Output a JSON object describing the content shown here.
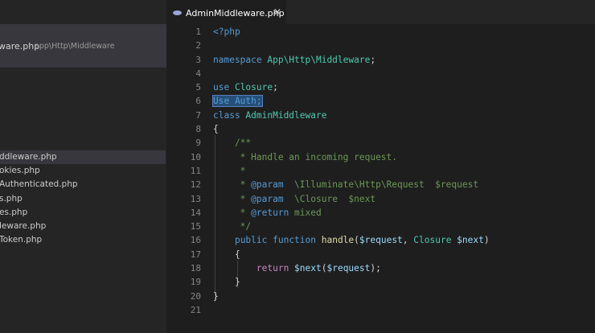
{
  "sidebar": {
    "open_editor": {
      "filename": "ware.php",
      "path": "app\\Http\\Middleware"
    },
    "files": [
      {
        "label": "ddleware.php",
        "active": true
      },
      {
        "label": "okies.php",
        "active": false
      },
      {
        "label": "Authenticated.php",
        "active": false
      },
      {
        "label": "s.php",
        "active": false
      },
      {
        "label": "es.php",
        "active": false
      },
      {
        "label": "leware.php",
        "active": false
      },
      {
        "label": "Token.php",
        "active": false
      }
    ]
  },
  "tab": {
    "label": "AdminMiddleware.php",
    "close": "✕"
  },
  "editor": {
    "line_numbers": [
      "1",
      "2",
      "3",
      "4",
      "5",
      "6",
      "7",
      "8",
      "9",
      "10",
      "11",
      "12",
      "13",
      "14",
      "15",
      "16",
      "17",
      "18",
      "19",
      "20",
      "21"
    ],
    "lines": [
      [
        {
          "t": "<?php",
          "c": "kw"
        }
      ],
      [],
      [
        {
          "t": "namespace ",
          "c": "kw"
        },
        {
          "t": "App\\Http\\Middleware",
          "c": "ns"
        },
        {
          "t": ";",
          "c": "pl"
        }
      ],
      [],
      [
        {
          "t": "use ",
          "c": "kw"
        },
        {
          "t": "Closure",
          "c": "ns"
        },
        {
          "t": ";",
          "c": "pl"
        }
      ],
      [
        {
          "t": "Use Auth;",
          "c": "kw",
          "sel": true
        }
      ],
      [
        {
          "t": "class ",
          "c": "kw"
        },
        {
          "t": "AdminMiddleware",
          "c": "cl"
        }
      ],
      [
        {
          "t": "{",
          "c": "pl"
        }
      ],
      [
        {
          "t": "    /**",
          "c": "cm"
        }
      ],
      [
        {
          "t": "     * Handle an incoming request.",
          "c": "cm"
        }
      ],
      [
        {
          "t": "     *",
          "c": "cm"
        }
      ],
      [
        {
          "t": "     * ",
          "c": "cm"
        },
        {
          "t": "@param",
          "c": "kw"
        },
        {
          "t": "  \\Illuminate\\Http\\Request",
          "c": "cm"
        },
        {
          "t": "  $request",
          "c": "cm"
        }
      ],
      [
        {
          "t": "     * ",
          "c": "cm"
        },
        {
          "t": "@param",
          "c": "kw"
        },
        {
          "t": "  \\Closure",
          "c": "cm"
        },
        {
          "t": "  $next",
          "c": "cm"
        }
      ],
      [
        {
          "t": "     * ",
          "c": "cm"
        },
        {
          "t": "@return",
          "c": "kw"
        },
        {
          "t": " mixed",
          "c": "cm"
        }
      ],
      [
        {
          "t": "     */",
          "c": "cm"
        }
      ],
      [
        {
          "t": "    ",
          "c": "pl"
        },
        {
          "t": "public ",
          "c": "kw"
        },
        {
          "t": "function ",
          "c": "kw"
        },
        {
          "t": "handle",
          "c": "fn"
        },
        {
          "t": "(",
          "c": "pl"
        },
        {
          "t": "$request",
          "c": "vr"
        },
        {
          "t": ", ",
          "c": "pl"
        },
        {
          "t": "Closure ",
          "c": "cl"
        },
        {
          "t": "$next",
          "c": "vr"
        },
        {
          "t": ")",
          "c": "pl"
        }
      ],
      [
        {
          "t": "    {",
          "c": "pl"
        }
      ],
      [
        {
          "t": "        ",
          "c": "pl"
        },
        {
          "t": "return ",
          "c": "ctrl"
        },
        {
          "t": "$next",
          "c": "vr"
        },
        {
          "t": "(",
          "c": "pl"
        },
        {
          "t": "$request",
          "c": "vr"
        },
        {
          "t": ");",
          "c": "pl"
        }
      ],
      [
        {
          "t": "    }",
          "c": "pl"
        }
      ],
      [
        {
          "t": "}",
          "c": "pl"
        }
      ],
      []
    ]
  }
}
